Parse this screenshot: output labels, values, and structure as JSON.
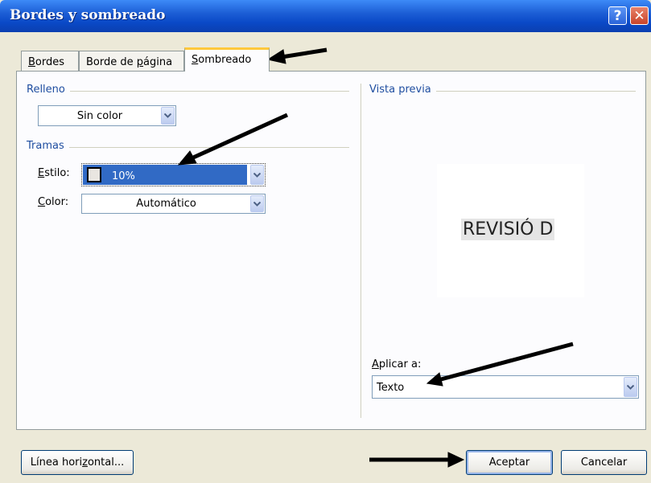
{
  "window": {
    "title": "Bordes y sombreado",
    "help_label": "?",
    "close_label": "✕"
  },
  "tabs": [
    {
      "label_pre": "",
      "label_u": "B",
      "label_post": "ordes"
    },
    {
      "label_pre": "Borde de ",
      "label_u": "p",
      "label_post": "ágina"
    },
    {
      "label_pre": "",
      "label_u": "S",
      "label_post": "ombreado"
    }
  ],
  "relleno": {
    "group_label": "Relleno",
    "value": "Sin color"
  },
  "tramas": {
    "group_label": "Tramas",
    "estilo_label_u": "E",
    "estilo_label_post": "stilo:",
    "estilo_value": "10%",
    "color_label_u": "C",
    "color_label_post": "olor:",
    "color_value": "Automático"
  },
  "preview": {
    "group_label": "Vista previa",
    "sample_text": "REVISIÓ D"
  },
  "apply": {
    "label_u": "A",
    "label_post": "plicar a:",
    "value": "Texto"
  },
  "buttons": {
    "linea_pre": "Línea hori",
    "linea_u": "z",
    "linea_post": "ontal...",
    "accept": "Aceptar",
    "cancel": "Cancelar"
  },
  "colors": {
    "accent": "#316ac5",
    "title_bar": "#0a49c7",
    "group_label": "#1f4ea0"
  }
}
